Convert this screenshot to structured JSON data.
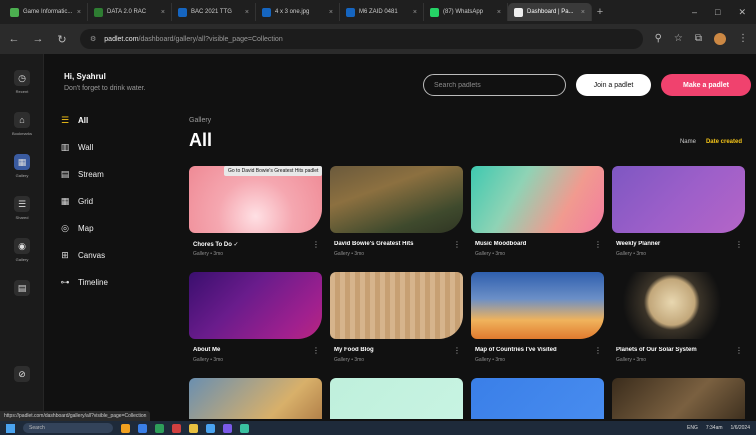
{
  "browser": {
    "tabs": [
      {
        "label": "Game Informatic...",
        "color": "#4caf50",
        "active": false
      },
      {
        "label": "DATA 2.0 RAC",
        "color": "#2e7d32",
        "active": false
      },
      {
        "label": "BAC 2021 TTG",
        "color": "#1565c0",
        "active": false
      },
      {
        "label": "4 x 3 one.jpg",
        "color": "#1565c0",
        "active": false
      },
      {
        "label": "M6 ZAID 0481",
        "color": "#1565c0",
        "active": false
      },
      {
        "label": "(87) WhatsApp",
        "color": "#25d366",
        "active": false
      },
      {
        "label": "Dashboard | Pa...",
        "color": "#eee",
        "active": true
      }
    ],
    "new_tab": "+",
    "window_controls": [
      "–",
      "□",
      "✕"
    ],
    "url_host": "padlet.com",
    "url_path": "/dashboard/gallery/all?visible_page=Collection"
  },
  "rail": {
    "items": [
      {
        "label": "Recent",
        "icon": "clock-icon",
        "glyph": "◷"
      },
      {
        "label": "Bookmarks",
        "icon": "bookmark-icon",
        "glyph": "⌂"
      },
      {
        "label": "Gallery",
        "icon": "gallery-icon",
        "glyph": "▦",
        "active": true
      },
      {
        "label": "Shared",
        "icon": "shared-icon",
        "glyph": "☰"
      },
      {
        "label": "Gallery",
        "icon": "globe-icon",
        "glyph": "◉"
      },
      {
        "label": "",
        "icon": "doc-icon",
        "glyph": "▤"
      }
    ],
    "bottom_icon": "⊘"
  },
  "greeting": {
    "title": "Hi, Syahrul",
    "subtitle": "Don't forget to drink water."
  },
  "nav": [
    {
      "label": "All",
      "icon": "all-icon",
      "glyph": "☰",
      "active": true
    },
    {
      "label": "Wall",
      "icon": "wall-icon",
      "glyph": "▥"
    },
    {
      "label": "Stream",
      "icon": "stream-icon",
      "glyph": "▤"
    },
    {
      "label": "Grid",
      "icon": "grid-icon",
      "glyph": "▦"
    },
    {
      "label": "Map",
      "icon": "map-icon",
      "glyph": "◎"
    },
    {
      "label": "Canvas",
      "icon": "canvas-icon",
      "glyph": "⊞"
    },
    {
      "label": "Timeline",
      "icon": "timeline-icon",
      "glyph": "⊶"
    }
  ],
  "header": {
    "search_placeholder": "Search padlets",
    "join_label": "Join a padlet",
    "make_label": "Make a padlet"
  },
  "page": {
    "section": "Gallery",
    "title": "All",
    "sort_name": "Name",
    "sort_date": "Date created"
  },
  "cards": [
    {
      "title": "Chores To Do ✓",
      "meta": "Gallery • 3mo",
      "bg": "radial-gradient(circle at 50% 75%, #ffe0e4 0%, #f5a7b0 45%, #ef8a95 100%)"
    },
    {
      "title": "David Bowie's Greatest Hits",
      "meta": "Gallery • 3mo",
      "bg": "linear-gradient(160deg, #6b5a3c 0%, #8c7040 35%, #3f4a2d 75%, #2f3523 100%)"
    },
    {
      "title": "Music Moodboard",
      "meta": "Gallery • 3mo",
      "bg": "linear-gradient(120deg, #3ec9b0 0%, #8fd3b5 35%, #f19a8f 70%, #f27ca0 100%)"
    },
    {
      "title": "Weekly Planner",
      "meta": "Gallery • 3mo",
      "bg": "linear-gradient(135deg, #7e57c2 0%, #9c5fc9 50%, #b565c8 100%)"
    },
    {
      "title": "About Me",
      "meta": "Gallery • 3mo",
      "bg": "linear-gradient(135deg, #3a0f6e 0%, #6a1c8c 40%, #a0208e 80%, #b8267f 100%)"
    },
    {
      "title": "My Food Blog",
      "meta": "Gallery • 3mo",
      "bg": "repeating-linear-gradient(90deg, #d6b48c 0px, #d6b48c 5px, #c7a073 5px, #c7a073 10px)"
    },
    {
      "title": "Map of Countries I've Visited",
      "meta": "Gallery • 3mo",
      "bg": "linear-gradient(180deg, #2f5fae 0%, #6b8fc7 40%, #f0b35c 72%, #e07a2e 100%)"
    },
    {
      "title": "Planets of Our Solar System",
      "meta": "Gallery • 3mo",
      "bg": "radial-gradient(circle at 45% 45%, #e8d7b0 0%, #c2a77a 28%, #3a3328 34%, #111 60%)"
    },
    {
      "title": "",
      "meta": "",
      "bg": "linear-gradient(135deg, #6a8fb0 0%, #d8b06a 60%, #a06a3a 100%)"
    },
    {
      "title": "",
      "meta": "",
      "bg": "linear-gradient(135deg, #bff0dc 0%, #c9f4e3 100%)"
    },
    {
      "title": "",
      "meta": "",
      "bg": "linear-gradient(135deg, #3a7fe8 0%, #4a8ef0 100%)"
    },
    {
      "title": "",
      "meta": "",
      "bg": "linear-gradient(135deg, #3a2c1c 0%, #7a6040 50%, #2a2014 100%)"
    }
  ],
  "tooltip": "Go to David Bowie's Greatest Hits padlet",
  "status_url": "https://padlet.com/dashboard/gallery/all?visible_page=Collection",
  "taskbar": {
    "search": "Search",
    "apps": [
      "#f0a020",
      "#3a7fe8",
      "#2e9e5a",
      "#d04040",
      "#e8c040",
      "#4aa3f0",
      "#7a5ae8",
      "#3ac0a0"
    ],
    "tray": [
      "ENG",
      "7:34am",
      "1/6/2024"
    ]
  }
}
